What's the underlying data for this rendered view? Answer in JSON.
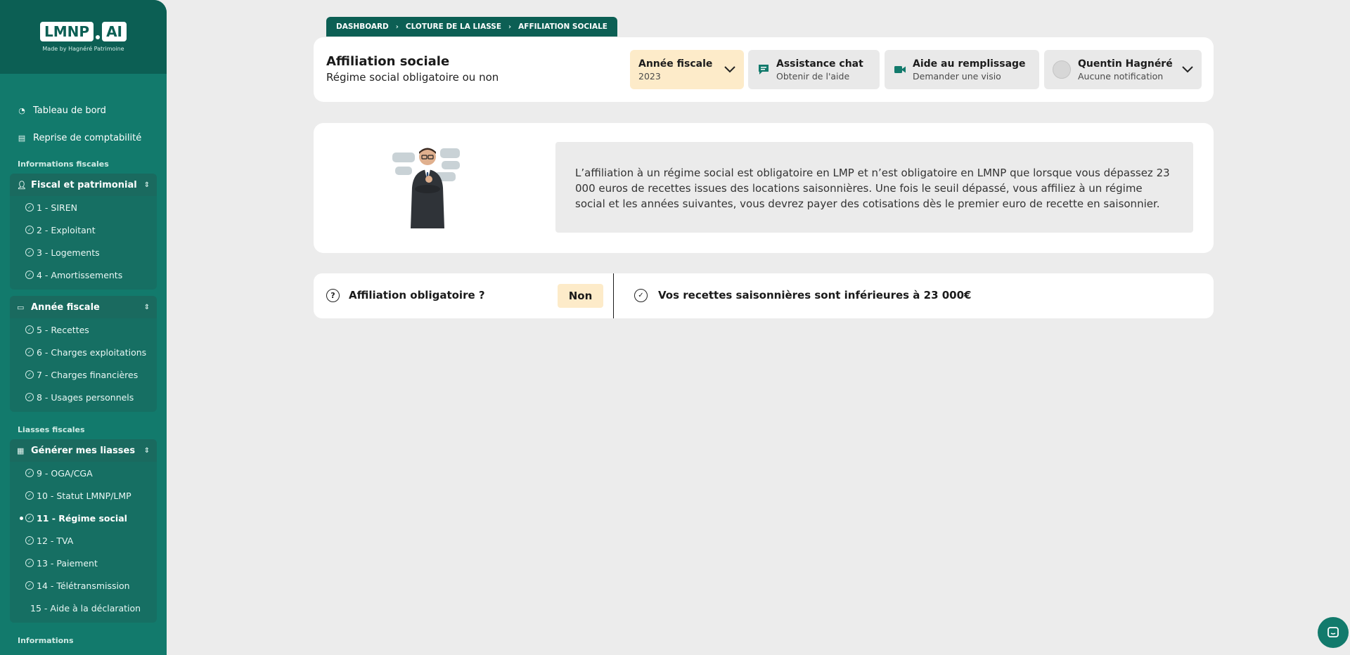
{
  "brand": {
    "logo_left": "LMNP",
    "logo_right": "AI",
    "tagline": "Made by Hagnéré Patrimoine"
  },
  "sidebar": {
    "top_items": [
      {
        "label": "Tableau de bord",
        "icon": "dashboard-icon"
      },
      {
        "label": "Reprise de comptabilité",
        "icon": "archive-icon"
      }
    ],
    "sections": [
      {
        "title": "Informations fiscales",
        "groups": [
          {
            "label": "Fiscal et patrimonial",
            "icon": "user-icon",
            "items": [
              "1 - SIREN",
              "2 - Exploitant",
              "3 - Logements",
              "4 - Amortissements"
            ]
          },
          {
            "label": "Année fiscale",
            "icon": "calendar-icon",
            "items": [
              "5 - Recettes",
              "6 - Charges exploitations",
              "7 - Charges financières",
              "8 - Usages personnels"
            ]
          }
        ]
      },
      {
        "title": "Liasses fiscales",
        "groups": [
          {
            "label": "Générer mes liasses",
            "icon": "document-icon",
            "items": [
              "9 - OGA/CGA",
              "10 - Statut LMNP/LMP",
              "11 - Régime social",
              "12 - TVA",
              "13 - Paiement",
              "14 - Télétransmission",
              "15 - Aide à la déclaration"
            ]
          }
        ]
      }
    ],
    "cut_off_section": "Informations"
  },
  "breadcrumb": [
    "DASHBOARD",
    "CLOTURE DE LA LIASSE",
    "AFFILIATION SOCIALE"
  ],
  "header": {
    "title": "Affiliation sociale",
    "subtitle": "Régime social obligatoire ou non",
    "year_button": {
      "label": "Année fiscale",
      "value": "2023"
    },
    "chat_button": {
      "label": "Assistance chat",
      "sub": "Obtenir de l'aide"
    },
    "help_button": {
      "label": "Aide au remplissage",
      "sub": "Demander une visio"
    },
    "user_button": {
      "label": "Quentin Hagnéré",
      "sub": "Aucune notification"
    }
  },
  "info": {
    "text": "L’affiliation à un régime social est obligatoire en LMP et n’est obligatoire en LMNP que lorsque vous dépassez 23 000 euros de recettes issues des locations saisonnières. Une fois le seuil dépassé, vous affiliez à un régime social et les années suivantes, vous devrez payer des cotisations dès le premier euro de recette en saisonnier."
  },
  "affiliation": {
    "question": "Affiliation obligatoire ?",
    "answer": "Non",
    "message": "Vos recettes saisonnières sont inférieures à 23 000€"
  },
  "colors": {
    "sidebar": "#127a6c",
    "sidebar_dark": "#0c5f54",
    "highlight": "#fdebc9"
  }
}
